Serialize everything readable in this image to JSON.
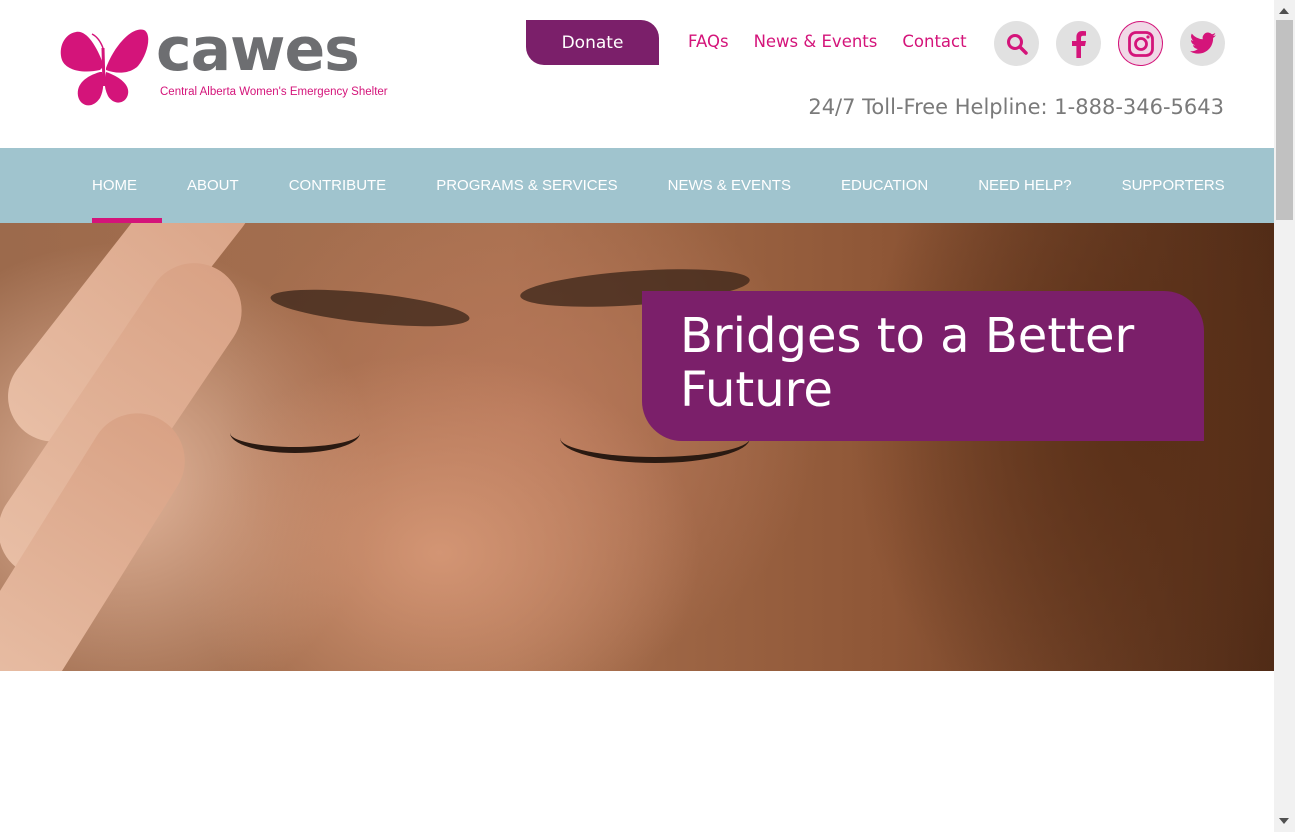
{
  "logo": {
    "wordmark": "cawes",
    "tagline": "Central Alberta Women's Emergency Shelter",
    "icon": "butterfly-icon"
  },
  "header": {
    "donate_label": "Donate",
    "links": [
      "FAQs",
      "News & Events",
      "Contact"
    ],
    "helpline_label": "24/7 Toll-Free Helpline:",
    "helpline_number": "1-888-346-5643"
  },
  "social": [
    "search-icon",
    "facebook-icon",
    "instagram-icon",
    "twitter-icon"
  ],
  "nav": {
    "items": [
      "HOME",
      "ABOUT",
      "CONTRIBUTE",
      "PROGRAMS & SERVICES",
      "NEWS & EVENTS",
      "EDUCATION",
      "NEED HELP?",
      "SUPPORTERS"
    ],
    "active": "HOME"
  },
  "hero": {
    "headline": "Bridges to a Better Future"
  },
  "colors": {
    "brand_magenta": "#d4147a",
    "brand_purple": "#7b1f6a",
    "nav_bg": "#a0c4ce",
    "logo_gray": "#6d6e71"
  }
}
